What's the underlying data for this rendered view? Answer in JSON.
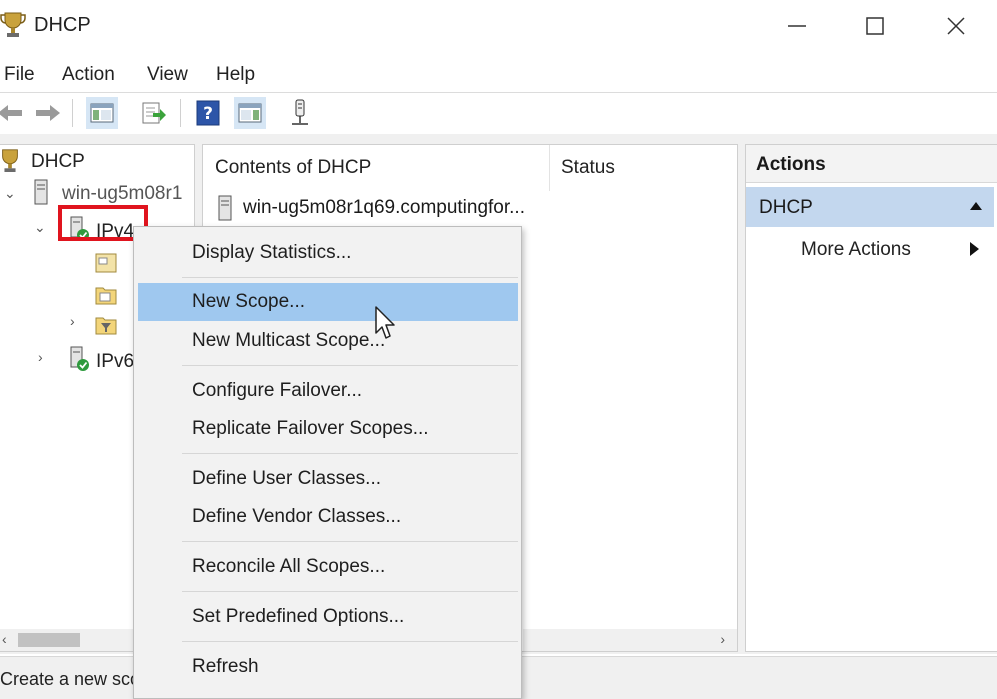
{
  "window": {
    "title": "DHCP",
    "minimize_label": "—",
    "maximize_label": "☐",
    "close_label": "✕"
  },
  "menu": {
    "items": [
      "File",
      "Action",
      "View",
      "Help"
    ]
  },
  "toolbar": {
    "icons": [
      "back-arrow-icon",
      "forward-arrow-icon",
      "show-hide-tree-icon",
      "export-list-icon",
      "help-icon",
      "show-hide-action-pane-icon",
      "server-status-icon"
    ]
  },
  "tree": {
    "root": "DHCP",
    "server": "win-ug5m08r1",
    "ipv4": "IPv4",
    "ipv6": "IPv6"
  },
  "content": {
    "col_contents": "Contents of DHCP",
    "col_status": "Status",
    "rows": [
      {
        "name": "win-ug5m08r1q69.computingfor..."
      }
    ]
  },
  "actions": {
    "title": "Actions",
    "section": "DHCP",
    "more": "More Actions"
  },
  "context_menu": {
    "items": [
      "Display Statistics...",
      "New Scope...",
      "New Multicast Scope...",
      "Configure Failover...",
      "Replicate Failover Scopes...",
      "Define User Classes...",
      "Define Vendor Classes...",
      "Reconcile All Scopes...",
      "Set Predefined Options...",
      "Refresh"
    ],
    "highlighted": "New Scope..."
  },
  "status": {
    "text": "Create a new sco"
  },
  "colors": {
    "highlight": "#9fc8ef",
    "action_selected": "#c3d7ee",
    "annotation_box": "#e0141e"
  }
}
